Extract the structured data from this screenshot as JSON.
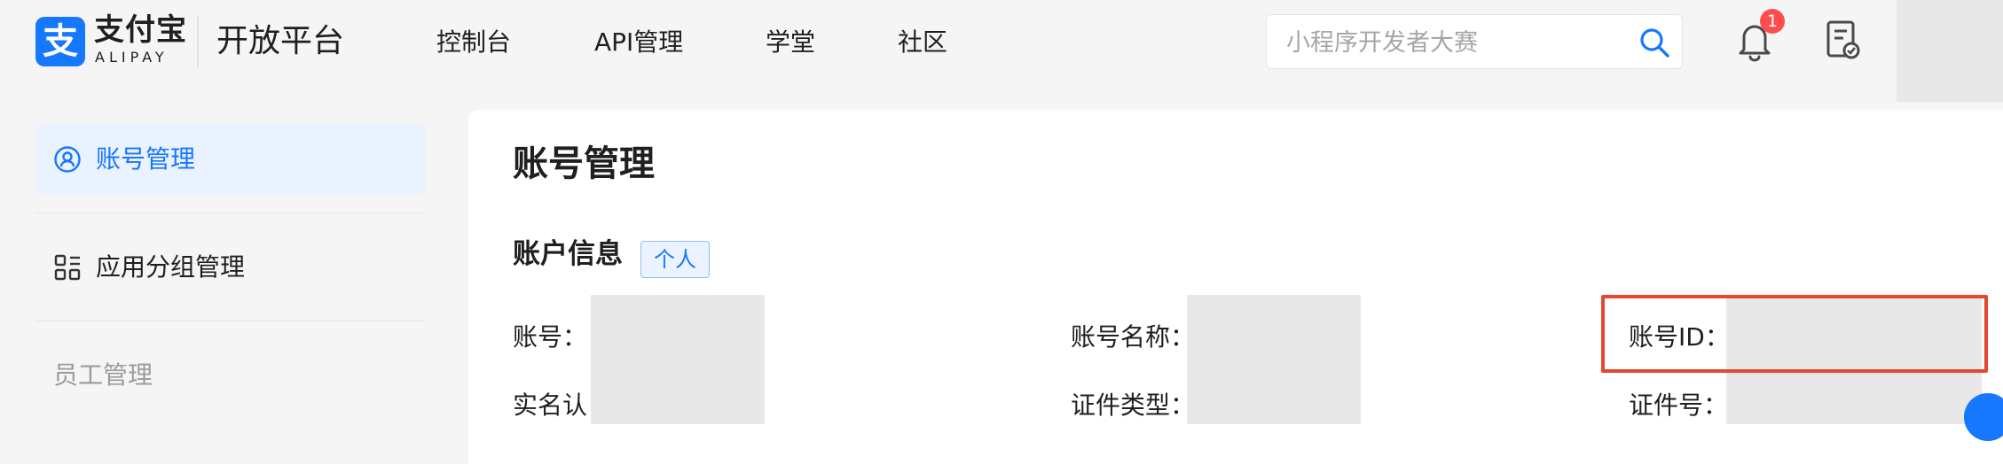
{
  "header": {
    "logo": {
      "cn": "支付宝",
      "en": "ALIPAY",
      "mark": "支"
    },
    "platform_title": "开放平台",
    "nav": [
      {
        "label": "控制台"
      },
      {
        "label": "API管理"
      },
      {
        "label": "学堂"
      },
      {
        "label": "社区"
      }
    ],
    "search": {
      "placeholder": "小程序开发者大赛",
      "value": "",
      "icon": "search-icon"
    },
    "notifications": {
      "icon": "bell-icon",
      "count": "1"
    },
    "tasks": {
      "icon": "task-list-icon"
    }
  },
  "sidebar": {
    "items": [
      {
        "label": "账号管理",
        "icon": "user-circle-icon",
        "active": true
      },
      {
        "label": "应用分组管理",
        "icon": "app-grid-icon",
        "active": false
      },
      {
        "label": "员工管理",
        "active": false
      }
    ]
  },
  "main": {
    "title": "账号管理",
    "section": {
      "title": "账户信息",
      "tag": "个人"
    },
    "fields": [
      {
        "label": "账号：",
        "value": ""
      },
      {
        "label": "账号名称：",
        "value": ""
      },
      {
        "label": "账号ID：",
        "value": ""
      },
      {
        "label": "实名认",
        "value": ""
      },
      {
        "label": "证件类型：",
        "value": ""
      },
      {
        "label": "证件号：",
        "value": ""
      }
    ]
  },
  "colors": {
    "brand": "#1677ff",
    "badge": "#ff4d4f",
    "highlight": "#e2492f",
    "active_bg": "#eaf1ff"
  }
}
